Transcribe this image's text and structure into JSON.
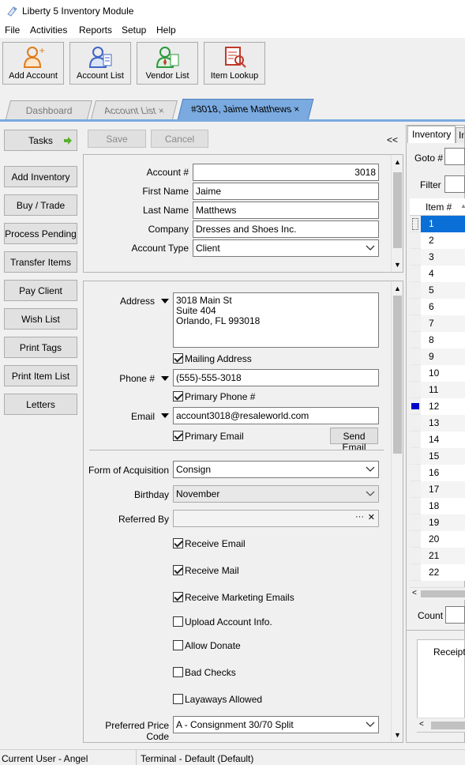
{
  "window": {
    "title": "Liberty 5 Inventory Module"
  },
  "menu": [
    "File",
    "Activities",
    "Reports",
    "Setup",
    "Help"
  ],
  "toolbar": {
    "add_account": "Add Account",
    "account_list": "Account List",
    "vendor_list": "Vendor List",
    "item_lookup": "Item Lookup"
  },
  "tabs": {
    "dashboard": "Dashboard",
    "account_list": "Account List",
    "account": "#3018, Jaime Matthews",
    "close": "×"
  },
  "sidebar": {
    "tasks": "Tasks",
    "items": [
      "Add Inventory",
      "Buy / Trade",
      "Process Pending",
      "Transfer Items",
      "Pay Client",
      "Wish List",
      "Print Tags",
      "Print Item List",
      "Letters"
    ]
  },
  "actions": {
    "save": "Save",
    "cancel": "Cancel",
    "collapse": "<<"
  },
  "account": {
    "number_label": "Account #",
    "number": "3018",
    "first_name_label": "First Name",
    "first_name": "Jaime",
    "last_name_label": "Last Name",
    "last_name": "Matthews",
    "company_label": "Company",
    "company": "Dresses and Shoes Inc.",
    "type_label": "Account Type",
    "type": "Client"
  },
  "contact": {
    "address_label": "Address",
    "address_line1": "3018 Main St",
    "address_line2": "Suite 404",
    "address_line3": "Orlando, FL  993018",
    "mailing_address": "Mailing Address",
    "phone_label": "Phone #",
    "phone": "(555)-555-3018",
    "primary_phone": "Primary Phone #",
    "email_label": "Email",
    "email": "account3018@resaleworld.com",
    "primary_email": "Primary Email",
    "send_email": "Send Email"
  },
  "details": {
    "form_label": "Form of Acquisition",
    "form": "Consign",
    "birthday_label": "Birthday",
    "birthday": "November",
    "referred_label": "Referred By",
    "referred": "",
    "referred_dots": "···",
    "referred_clear": "✕",
    "receive_email": "Receive Email",
    "receive_mail": "Receive Mail",
    "receive_marketing": "Receive Marketing Emails",
    "upload_account": "Upload Account Info.",
    "allow_donate": "Allow Donate",
    "bad_checks": "Bad Checks",
    "layaways": "Layaways Allowed",
    "price_code_label": "Preferred Price Code",
    "price_code": "A - Consignment 30/70 Split"
  },
  "right": {
    "tab_inventory": "Inventory",
    "tab_next": "In",
    "goto_label": "Goto #",
    "filter_label": "Filter",
    "item_header": "Item #",
    "items": [
      "1",
      "2",
      "3",
      "4",
      "5",
      "6",
      "7",
      "8",
      "9",
      "10",
      "11",
      "12",
      "13",
      "14",
      "15",
      "16",
      "17",
      "18",
      "19",
      "20",
      "21",
      "22"
    ],
    "count_label": "Count",
    "receipt": "Receipt"
  },
  "status": {
    "user": "Current User - Angel",
    "terminal": "Terminal - Default (Default)"
  },
  "colors": {
    "accent": "#7aaae0",
    "selection": "#0a70d8",
    "marker": "#0000cc"
  }
}
